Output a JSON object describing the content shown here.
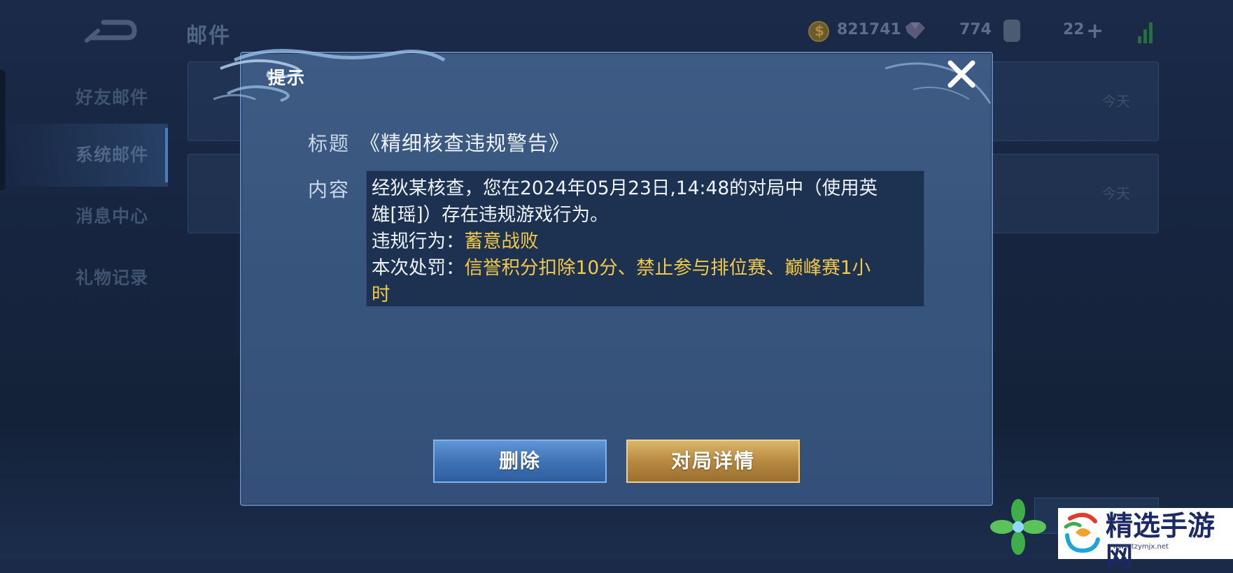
{
  "header": {
    "page_title": "邮件",
    "gold_count": "821741",
    "gem_count": "774",
    "voucher_count": "22"
  },
  "sidebar": {
    "items": [
      {
        "label": "好友邮件"
      },
      {
        "label": "系统邮件"
      },
      {
        "label": "消息中心"
      },
      {
        "label": "礼物记录"
      }
    ],
    "active_index": 1
  },
  "mail_list": [
    {
      "date": "今天"
    },
    {
      "date": "今天"
    }
  ],
  "dialog": {
    "title": "提示",
    "subject_label": "标题",
    "subject_value": "《精细核查违规警告》",
    "content_label": "内容",
    "content": {
      "line1": "经狄某核查，您在2024年05月23日,14:48的对局中（使用英",
      "line2": "雄[瑶]）存在违规游戏行为。",
      "violation_label": "违规行为：",
      "violation_value": "蓄意战败",
      "penalty_label": "本次处罚：",
      "penalty_value": "信誉积分扣除10分、禁止参与排位赛、巅峰赛1小",
      "penalty_value_cont": "时"
    },
    "delete_label": "删除",
    "details_label": "对局详情"
  },
  "watermark": {
    "text": "精选手游网",
    "url": "www.tzymjx.net"
  },
  "colors": {
    "dialog_bg": "#3a5880",
    "highlight_yellow": "#f4c948",
    "delete_button": "#4a80c2",
    "details_button": "#c09a50"
  }
}
